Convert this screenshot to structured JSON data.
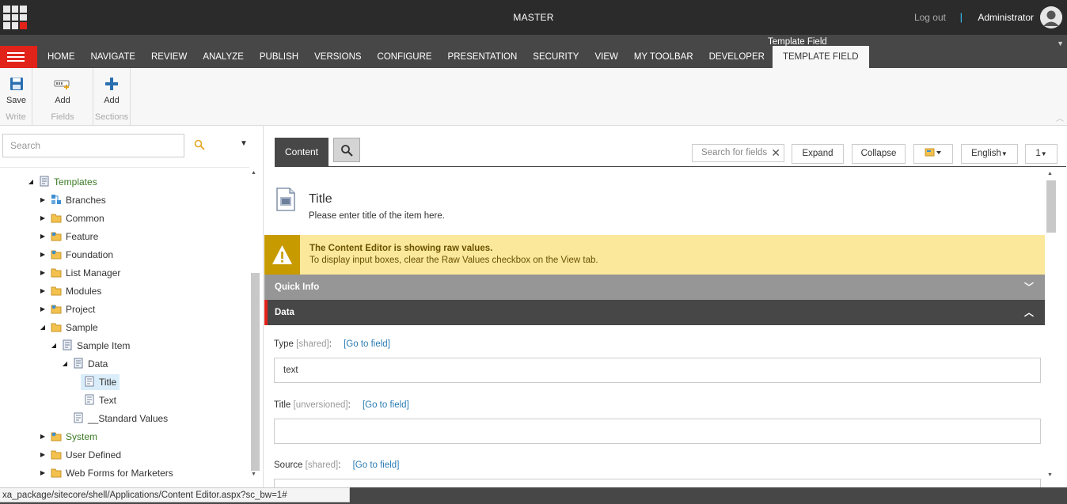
{
  "topbar": {
    "database": "MASTER",
    "logout": "Log out",
    "separator": "|",
    "user": "Administrator"
  },
  "ribbon": {
    "context_title": "Template Field",
    "tabs": [
      "HOME",
      "NAVIGATE",
      "REVIEW",
      "ANALYZE",
      "PUBLISH",
      "VERSIONS",
      "CONFIGURE",
      "PRESENTATION",
      "SECURITY",
      "VIEW",
      "MY TOOLBAR",
      "DEVELOPER",
      "TEMPLATE FIELD"
    ],
    "active_tab": "TEMPLATE FIELD",
    "groups": [
      {
        "name": "Write",
        "button": "Save",
        "icon": "save-icon"
      },
      {
        "name": "Fields",
        "button": "Add",
        "icon": "add-field-icon"
      },
      {
        "name": "Sections",
        "button": "Add",
        "icon": "plus-icon"
      }
    ]
  },
  "tree": {
    "search_placeholder": "Search",
    "nodes": [
      {
        "label": "Templates",
        "green": true
      },
      {
        "label": "Branches"
      },
      {
        "label": "Common"
      },
      {
        "label": "Feature"
      },
      {
        "label": "Foundation"
      },
      {
        "label": "List Manager"
      },
      {
        "label": "Modules"
      },
      {
        "label": "Project"
      },
      {
        "label": "Sample"
      },
      {
        "label": "Sample Item"
      },
      {
        "label": "Data"
      },
      {
        "label": "Title",
        "selected": true
      },
      {
        "label": "Text"
      },
      {
        "label": "__Standard Values"
      },
      {
        "label": "System",
        "green": true
      },
      {
        "label": "User Defined"
      },
      {
        "label": "Web Forms for Marketers"
      }
    ]
  },
  "editor": {
    "tab_content": "Content",
    "search_fields_placeholder": "Search for fields",
    "expand": "Expand",
    "collapse": "Collapse",
    "language": "English",
    "version": "1",
    "item": {
      "title": "Title",
      "subtitle": "Please enter title of the item here."
    },
    "warning": {
      "title": "The Content Editor is showing raw values.",
      "text": "To display input boxes, clear the Raw Values checkbox on the View tab."
    },
    "sections": {
      "quick_info": "Quick Info",
      "data": "Data"
    },
    "fields": [
      {
        "name": "Type",
        "meta": "[shared]",
        "goto": "[Go to field]",
        "value": "text"
      },
      {
        "name": "Title",
        "meta": "[unversioned]",
        "goto": "[Go to field]",
        "value": ""
      },
      {
        "name": "Source",
        "meta": "[shared]",
        "goto": "[Go to field]",
        "value": ""
      }
    ]
  },
  "status": {
    "url": "xa_package/sitecore/shell/Applications/Content Editor.aspx?sc_bw=1#"
  },
  "colors": {
    "accent_red": "#e2231a",
    "dark": "#2b2b2b",
    "ribbon": "#474747",
    "warning_bg": "#fbe89b"
  }
}
